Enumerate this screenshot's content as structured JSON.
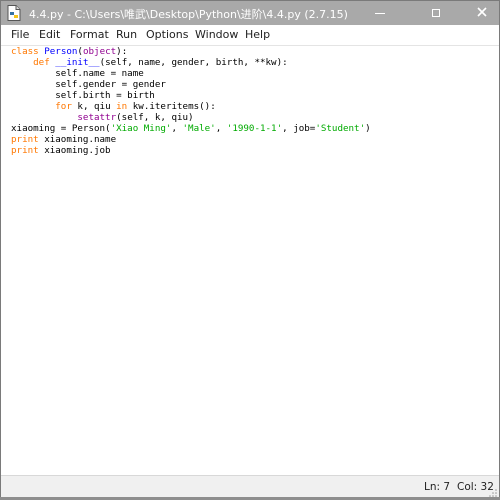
{
  "window": {
    "title": "4.4.py - C:\\Users\\唯武\\Desktop\\Python\\进阶\\4.4.py (2.7.15)",
    "icon": "python-file-icon",
    "controls": {
      "minimize": "minimize-icon",
      "maximize": "maximize-icon",
      "close": "close-icon"
    }
  },
  "menu": {
    "items": [
      "File",
      "Edit",
      "Format",
      "Run",
      "Options",
      "Window",
      "Help"
    ]
  },
  "editor": {
    "lines": [
      "class Person(object):",
      "    def __init__(self, name, gender, birth, **kw):",
      "        self.name = name",
      "        self.gender = gender",
      "        self.birth = birth",
      "        for k, qiu in kw.iteritems():",
      "            setattr(self, k, qiu)",
      "xiaoming = Person('Xiao Ming', 'Male', '1990-1-1', job='Student')",
      "print xiaoming.name",
      "print xiaoming.job"
    ]
  },
  "status": {
    "line": "Ln: 7",
    "column": "Col: 32"
  },
  "colors": {
    "titlebar": "#a9a9a9",
    "keyword": "#ff7700",
    "definition": "#0000ff",
    "string": "#00aa00",
    "builtin": "#900090"
  }
}
